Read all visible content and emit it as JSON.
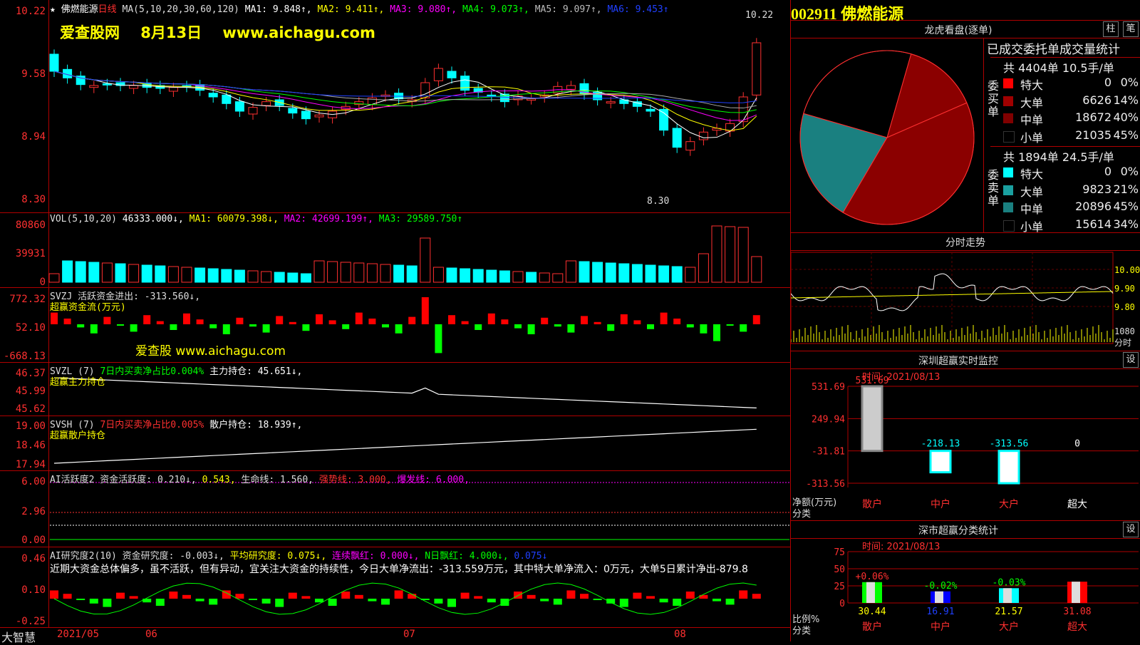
{
  "main": {
    "title_star": "★",
    "stock_name": "佛燃能源",
    "period": "日线",
    "ma_params": "MA(5,10,20,30,60,120)",
    "ma1": "MA1: 9.848↑,",
    "ma2": "MA2: 9.411↑,",
    "ma3": "MA3: 9.080↑,",
    "ma4": "MA4: 9.073↑,",
    "ma5": "MA5: 9.097↑,",
    "ma6": "MA6: 9.453↑",
    "watermark_site": "爱查股网",
    "watermark_date": "8月13日",
    "watermark_url": "www.aichagu.com",
    "high_label": "10.22",
    "low_label": "8.30",
    "y_ticks": [
      "10.22",
      "9.58",
      "8.94",
      "8.30"
    ]
  },
  "vol": {
    "title": "VOL(5,10,20)",
    "value": "46333.000↓,",
    "ma1": "MA1: 60079.398↓,",
    "ma2": "MA2: 42699.199↑,",
    "ma3": "MA3: 29589.750↑",
    "y_ticks": [
      "80860",
      "39931",
      "0"
    ]
  },
  "svzj": {
    "title": "SVZJ  活跃资金进出: -313.560↓,",
    "subtitle": "超赢资金流(万元)",
    "watermark": "爱查股 www.aichagu.com",
    "y_ticks": [
      "772.32",
      "52.10",
      "-668.13"
    ]
  },
  "svzl": {
    "title_a": "SVZL (7)",
    "title_b": "7日内买卖净占比0.004%",
    "title_c": "主力持仓: 45.651↓,",
    "subtitle": "超赢主力持仓",
    "y_ticks": [
      "46.37",
      "45.99",
      "45.62"
    ]
  },
  "svsh": {
    "title_a": "SVSH (7)",
    "title_b": "7日内买卖净占比0.005%",
    "title_c": "散户持仓: 18.939↑,",
    "subtitle": "超赢散户持仓",
    "y_ticks": [
      "19.00",
      "18.46",
      "17.94"
    ]
  },
  "ai1": {
    "title_a": "AI活跃度2 资金活跃度: 0.210↓,",
    "title_b": "0.543,",
    "title_c": "生命线: 1.560,",
    "title_d": "强势线: 3.000,",
    "title_e": "爆发线: 6.000,",
    "y_ticks": [
      "6.00",
      "2.96",
      "0.00"
    ]
  },
  "ai2": {
    "title_a": "AI研究度2(10) 资金研究度: -0.003↓,",
    "title_b": "平均研究度: 0.075↓,",
    "title_c": "连续飘红: 0.000↓,",
    "title_d": "N日飘红: 4.000↓,",
    "title_e": "0.075↓",
    "comment": "近期大资金总体偏多，虽不活跃，但有异动，宜关注大资金的持续性，今日大单净流出：-313.559万元，其中特大单净流入：0万元，大单5日累计净出-879.8",
    "y_ticks": [
      "0.46",
      "0.10",
      "-0.25"
    ]
  },
  "xaxis": {
    "brand": "大智慧",
    "labels": [
      "2021/05",
      "06",
      "07",
      "08"
    ]
  },
  "right": {
    "code": "002911",
    "name": "佛燃能源",
    "lhb_title": "龙虎看盘(逐单)",
    "btn_zhu": "柱",
    "btn_bi": "笔",
    "stats_title": "已成交委托单成交量统计",
    "buy_summary": "共 4404单 10.5手/单",
    "buy_side_label": "委买单",
    "buy_rows": [
      {
        "label": "特大",
        "count": "0",
        "pct": "0%",
        "color": "#ff0000"
      },
      {
        "label": "大单",
        "count": "6626",
        "pct": "14%",
        "color": "#a00000"
      },
      {
        "label": "中单",
        "count": "18672",
        "pct": "40%",
        "color": "#800000"
      },
      {
        "label": "小单",
        "count": "21035",
        "pct": "45%",
        "color": "#000000"
      }
    ],
    "sell_summary": "共 1894单 24.5手/单",
    "sell_side_label": "委卖单",
    "sell_rows": [
      {
        "label": "特大",
        "count": "0",
        "pct": "0%",
        "color": "#00ffff"
      },
      {
        "label": "大单",
        "count": "9823",
        "pct": "21%",
        "color": "#1aa0a0"
      },
      {
        "label": "中单",
        "count": "20896",
        "pct": "45%",
        "color": "#1a8080"
      },
      {
        "label": "小单",
        "count": "15614",
        "pct": "34%",
        "color": "#000000"
      }
    ],
    "pie": {
      "slices": [
        {
          "name": "委买 大单",
          "pct": 14,
          "color": "#8b0000"
        },
        {
          "name": "委买 中单",
          "pct": 40,
          "color": "#8b0000"
        },
        {
          "name": "委卖 大单",
          "pct": 21,
          "color": "#1a8080"
        },
        {
          "name": "委卖 小单",
          "pct": 25,
          "color": "#000000"
        }
      ]
    },
    "intraday_title": "分时走势",
    "intraday_y": [
      "10.00",
      "9.90",
      "9.80",
      "1080",
      "分时"
    ],
    "monitor_title": "深圳超赢实时监控",
    "monitor_btn": "设",
    "monitor_time": "时间: 2021/08/13",
    "monitor_y": [
      "531.69",
      "249.94",
      "-31.81",
      "-313.56"
    ],
    "monitor_ylabel": "净额(万元)",
    "monitor_xlabel": "分类",
    "monitor_bars": [
      {
        "name": "散户",
        "value": 531.69,
        "label": "531.69"
      },
      {
        "name": "中户",
        "value": -218.13,
        "label": "-218.13"
      },
      {
        "name": "大户",
        "value": -313.56,
        "label": "-313.56"
      },
      {
        "name": "超大",
        "value": 0,
        "label": "0"
      }
    ],
    "class_title": "深市超赢分类统计",
    "class_btn": "设",
    "class_time": "时间: 2021/08/13",
    "class_y": [
      "75",
      "50",
      "25",
      "0"
    ],
    "class_ylabel": "比例%",
    "class_xlabel": "分类",
    "class_bars": [
      {
        "name": "散户",
        "value": 30.44,
        "label": "30.44",
        "change": "+0.06%"
      },
      {
        "name": "中户",
        "value": 16.91,
        "label": "16.91",
        "change": "-0.02%"
      },
      {
        "name": "大户",
        "value": 21.57,
        "label": "21.57",
        "change": "-0.03%"
      },
      {
        "name": "超大",
        "value": 31.08,
        "label": "31.08",
        "change": ""
      }
    ]
  }
}
